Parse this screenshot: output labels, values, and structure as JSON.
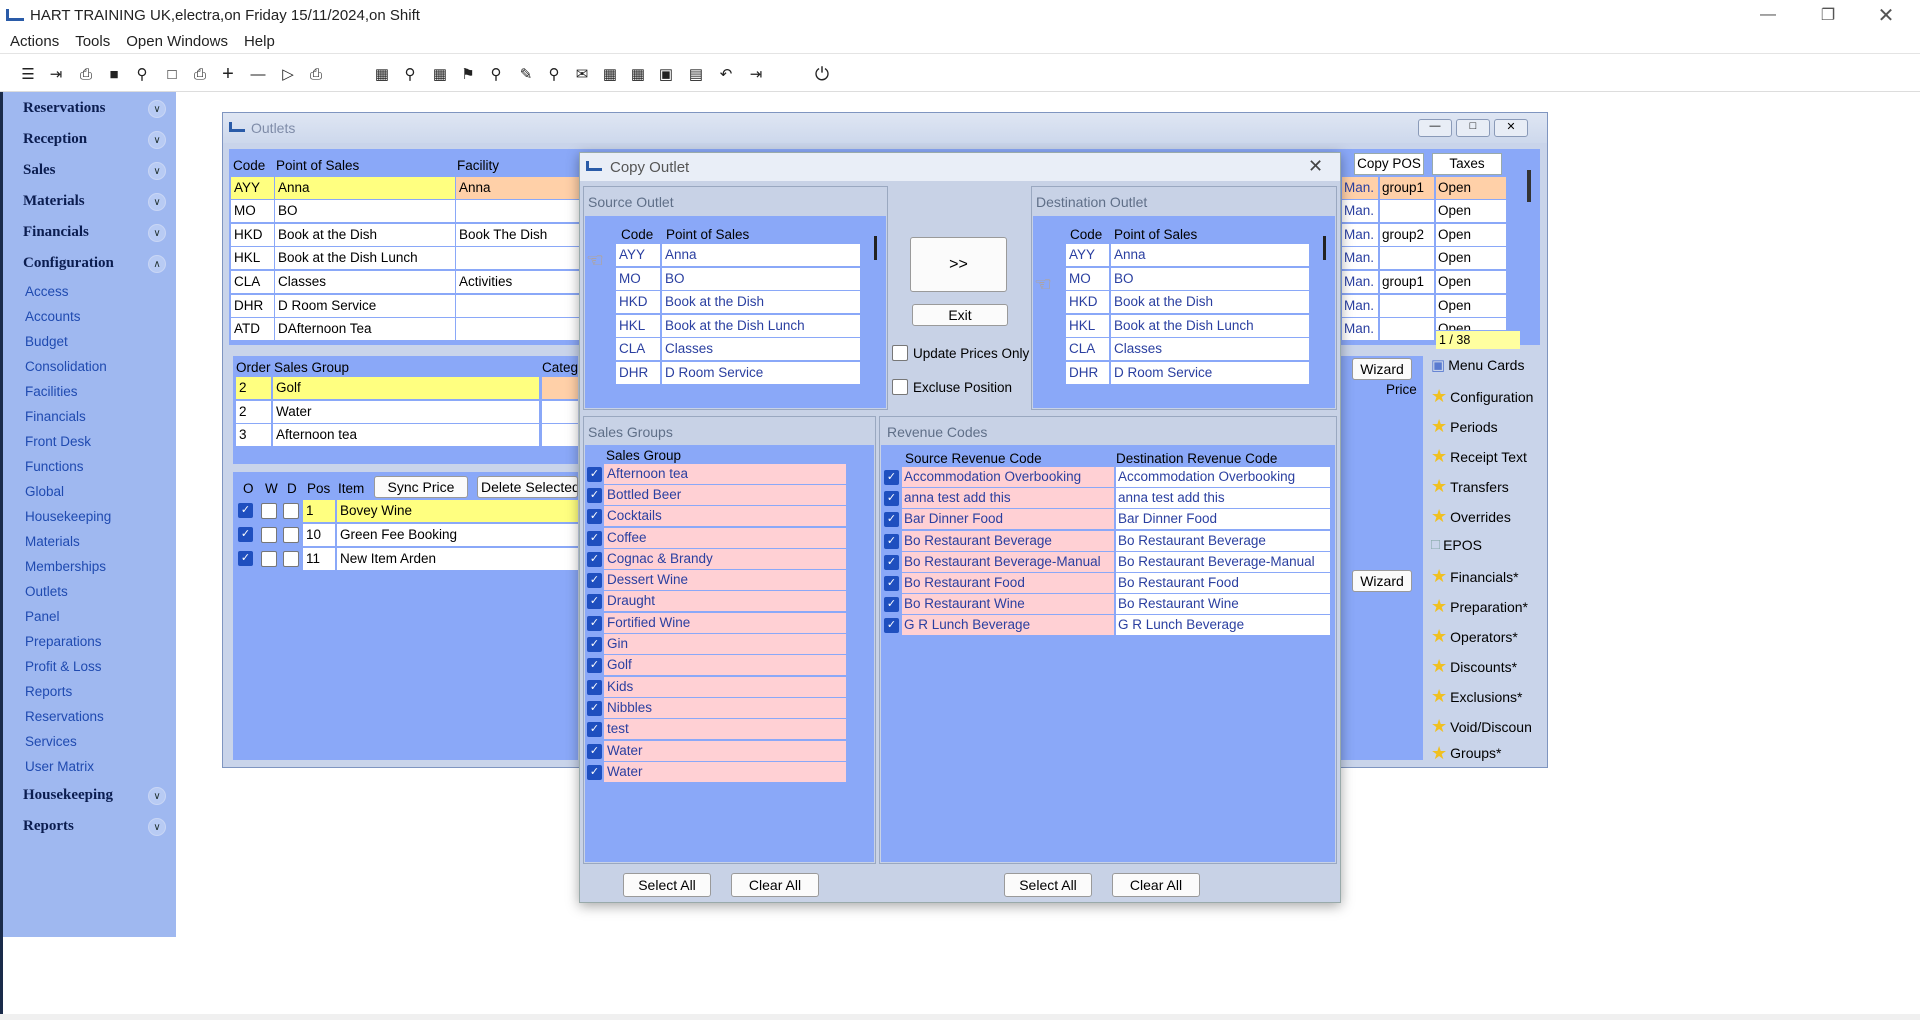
{
  "window_title": "HART TRAINING UK,electra,on Friday 15/11/2024,on Shift",
  "menu": [
    "Actions",
    "Tools",
    "Open Windows",
    "Help"
  ],
  "sidebar": {
    "sections_top": [
      "Reservations",
      "Reception",
      "Sales",
      "Materials",
      "Financials",
      "Configuration"
    ],
    "links": [
      "Access",
      "Accounts",
      "Budget",
      "Consolidation",
      "Facilities",
      "Financials",
      "Front Desk",
      "Functions",
      "Global",
      "Housekeeping",
      "Materials",
      "Memberships",
      "Outlets",
      "Panel",
      "Preparations",
      "Profit & Loss",
      "Reports",
      "Reservations",
      "Services",
      "User Matrix"
    ],
    "sections_bottom": [
      "Housekeeping",
      "Reports"
    ]
  },
  "outlets": {
    "title": "Outlets",
    "headers": {
      "code": "Code",
      "pos": "Point of Sales",
      "facility": "Facility",
      "copy_pos": "Copy POS",
      "taxes": "Taxes"
    },
    "rows": [
      {
        "code": "AYY",
        "pos": "Anna",
        "facility": "Anna",
        "man": "Man.",
        "group": "group1",
        "tax": "Open"
      },
      {
        "code": "MO",
        "pos": "BO",
        "facility": "",
        "man": "Man.",
        "group": "",
        "tax": "Open"
      },
      {
        "code": "HKD",
        "pos": "Book at the Dish",
        "facility": "Book The Dish",
        "man": "Man.",
        "group": "group2",
        "tax": "Open"
      },
      {
        "code": "HKL",
        "pos": "Book at the Dish Lunch",
        "facility": "",
        "man": "Man.",
        "group": "",
        "tax": "Open"
      },
      {
        "code": "CLA",
        "pos": "Classes",
        "facility": "Activities",
        "man": "Man.",
        "group": "group1",
        "tax": "Open"
      },
      {
        "code": "DHR",
        "pos": "D Room Service",
        "facility": "",
        "man": "Man.",
        "group": "",
        "tax": "Open"
      },
      {
        "code": "ATD",
        "pos": "DAfternoon Tea",
        "facility": "",
        "man": "Man.",
        "group": "",
        "tax": "Open"
      }
    ],
    "record_counter": "1 / 38",
    "sales_group_headers": {
      "order": "Order",
      "group": "Sales Group",
      "category": "Categ"
    },
    "sales_groups": [
      {
        "order": "2",
        "name": "Golf"
      },
      {
        "order": "2",
        "name": "Water"
      },
      {
        "order": "3",
        "name": "Afternoon tea"
      }
    ],
    "item_headers": {
      "o": "O",
      "w": "W",
      "d": "D",
      "pos": "Pos",
      "item": "Item"
    },
    "sync_price": "Sync Price",
    "delete_selected": "Delete Selected",
    "items": [
      {
        "pos": "1",
        "name": "Bovey Wine"
      },
      {
        "pos": "10",
        "name": "Green Fee Booking"
      },
      {
        "pos": "11",
        "name": "New Item Arden"
      }
    ],
    "wizard": "Wizard",
    "price": "Price",
    "right_menu": [
      "Menu Cards",
      "Configuration",
      "Periods",
      "Receipt Text",
      "Transfers",
      "Overrides",
      "EPOS",
      "Financials*",
      "Preparation*",
      "Operators*",
      "Discounts*",
      "Exclusions*",
      "Void/Discoun",
      "Groups*"
    ]
  },
  "dialog": {
    "title": "Copy Outlet",
    "source_title": "Source Outlet",
    "dest_title": "Destination Outlet",
    "list_headers": {
      "code": "Code",
      "pos": "Point of Sales"
    },
    "outlets": [
      {
        "code": "AYY",
        "pos": "Anna"
      },
      {
        "code": "MO",
        "pos": "BO"
      },
      {
        "code": "HKD",
        "pos": "Book at the Dish"
      },
      {
        "code": "HKL",
        "pos": "Book at the Dish Lunch"
      },
      {
        "code": "CLA",
        "pos": "Classes"
      },
      {
        "code": "DHR",
        "pos": "D Room Service"
      }
    ],
    "copy_button": ">>",
    "exit_button": "Exit",
    "update_prices_only": "Update Prices Only",
    "exclude_position": "Excluse Position",
    "sales_groups_title": "Sales Groups",
    "sales_group_header": "Sales Group",
    "sales_groups": [
      "Afternoon tea",
      "Bottled Beer",
      "Cocktails",
      "Coffee",
      "Cognac & Brandy",
      "Dessert Wine",
      "Draught",
      "Fortified Wine",
      "Gin",
      "Golf",
      "Kids",
      "Nibbles",
      "test",
      "Water",
      "Water"
    ],
    "revenue_title": "Revenue Codes",
    "revenue_headers": {
      "source": "Source Revenue Code",
      "dest": "Destination Revenue Code"
    },
    "revenue_codes": [
      {
        "source": "Accommodation Overbooking",
        "dest": "Accommodation Overbooking"
      },
      {
        "source": "anna test add this",
        "dest": "anna test add this"
      },
      {
        "source": "Bar Dinner Food",
        "dest": "Bar Dinner Food"
      },
      {
        "source": "Bo Restaurant  Beverage",
        "dest": "Bo Restaurant  Beverage"
      },
      {
        "source": "Bo Restaurant Beverage-Manual",
        "dest": "Bo Restaurant Beverage-Manual"
      },
      {
        "source": "Bo Restaurant Food",
        "dest": "Bo Restaurant Food"
      },
      {
        "source": "Bo Restaurant Wine",
        "dest": "Bo Restaurant Wine"
      },
      {
        "source": "G R Lunch Beverage",
        "dest": "G R Lunch Beverage"
      }
    ],
    "select_all": "Select All",
    "clear_all": "Clear All"
  }
}
